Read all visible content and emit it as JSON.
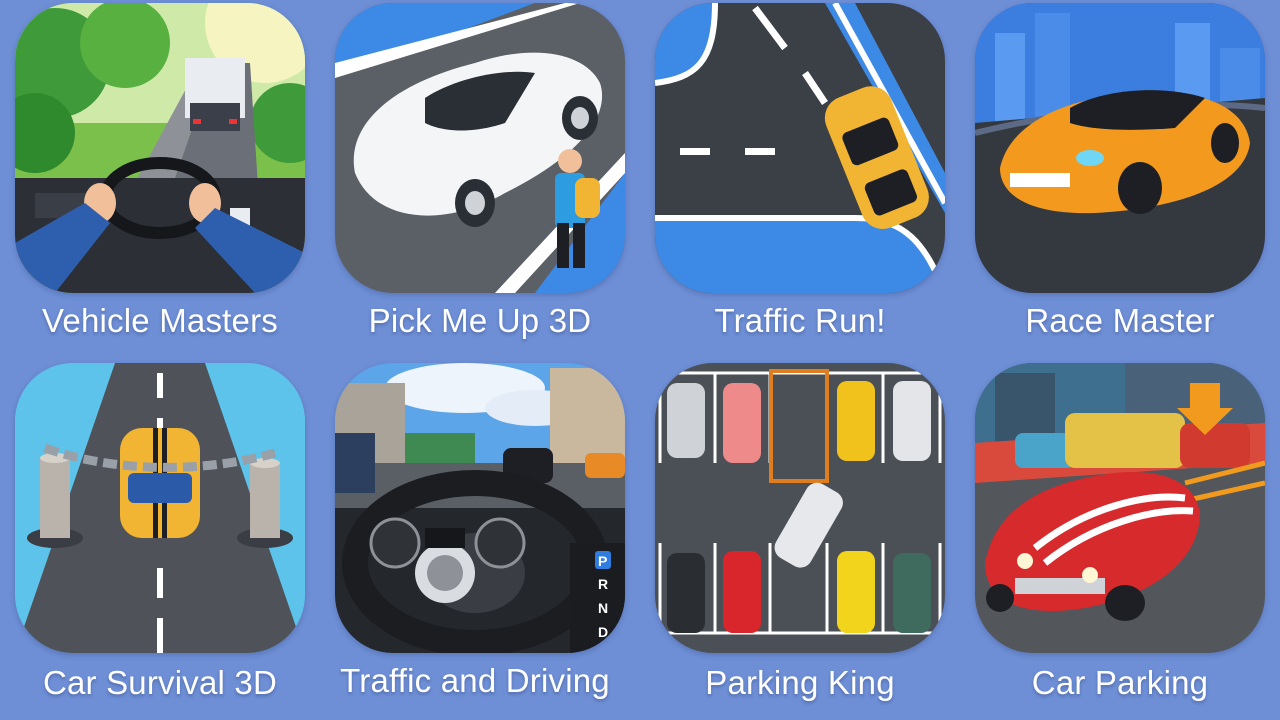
{
  "apps": [
    {
      "name": "Vehicle Masters"
    },
    {
      "name": "Pick Me Up 3D"
    },
    {
      "name": "Traffic Run!"
    },
    {
      "name": "Race Master"
    },
    {
      "name": "Car Survival 3D"
    },
    {
      "name": "Traffic and Driving"
    },
    {
      "name": "Parking King"
    },
    {
      "name": "Car Parking"
    }
  ],
  "gear_letters": [
    "P",
    "R",
    "N",
    "D"
  ],
  "colors": {
    "background": "#6e8fd6",
    "label": "#ffffff"
  }
}
